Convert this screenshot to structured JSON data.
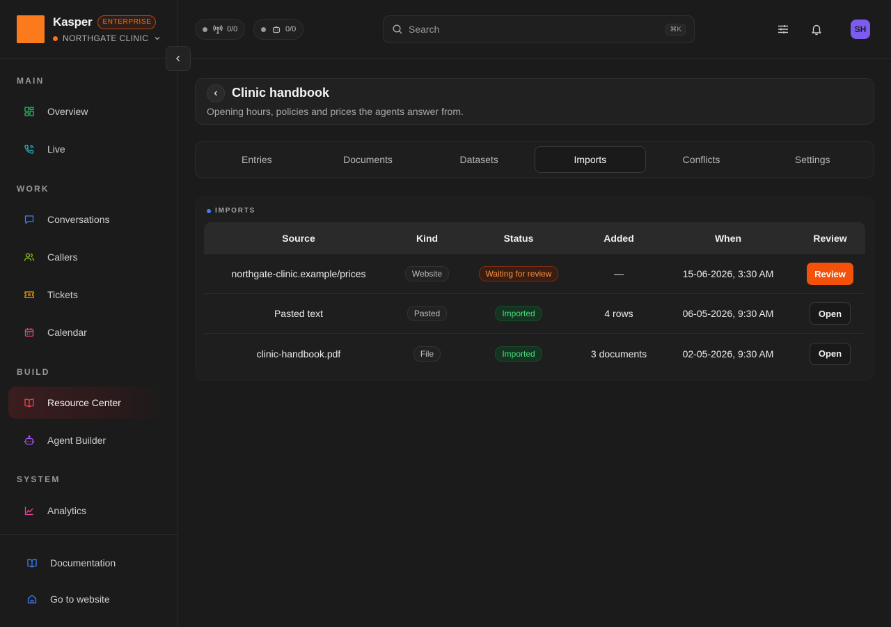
{
  "brand": {
    "name": "Kasper",
    "tier": "ENTERPRISE",
    "org": "NORTHGATE CLINIC"
  },
  "status_pills": [
    {
      "icon": "antenna-icon",
      "value": "0/0"
    },
    {
      "icon": "bot-icon",
      "value": "0/0"
    }
  ],
  "search": {
    "placeholder": "Search",
    "shortcut": "⌘K"
  },
  "user": {
    "initials": "SH"
  },
  "sidebar": {
    "sections": {
      "main": "MAIN",
      "work": "WORK",
      "build": "BUILD",
      "system": "SYSTEM"
    },
    "items": {
      "overview": "Overview",
      "live": "Live",
      "conversations": "Conversations",
      "callers": "Callers",
      "tickets": "Tickets",
      "calendar": "Calendar",
      "resource_center": "Resource Center",
      "agent_builder": "Agent Builder",
      "analytics": "Analytics",
      "documentation": "Documentation",
      "go_to_website": "Go to website"
    },
    "active": "resource_center",
    "icon_colors": {
      "overview": "#22c55e",
      "live": "#22b8cf",
      "conversations": "#3b82f6",
      "callers": "#84cc16",
      "tickets": "#f59e0b",
      "calendar": "#ec4899",
      "resource_center": "#ef4444",
      "agent_builder": "#a855f7",
      "analytics": "#ec4899",
      "documentation": "#3b82f6",
      "go_to_website": "#3b82f6"
    }
  },
  "page": {
    "title": "Clinic handbook",
    "subtitle": "Opening hours, policies and prices the agents answer from."
  },
  "tabs": [
    "Entries",
    "Documents",
    "Datasets",
    "Imports",
    "Conflicts",
    "Settings"
  ],
  "active_tab": "Imports",
  "imports": {
    "label": "IMPORTS",
    "columns": [
      "Source",
      "Kind",
      "Status",
      "Added",
      "When",
      "Review"
    ],
    "rows": [
      {
        "source": "northgate-clinic.example/prices",
        "kind": "Website",
        "status": "Waiting for review",
        "added": "—",
        "when": "15-06-2026, 3:30 AM",
        "action": "Review"
      },
      {
        "source": "Pasted text",
        "kind": "Pasted",
        "status": "Imported",
        "added": "4 rows",
        "when": "06-05-2026, 9:30 AM",
        "action": "Open"
      },
      {
        "source": "clinic-handbook.pdf",
        "kind": "File",
        "status": "Imported",
        "added": "3 documents",
        "when": "02-05-2026, 9:30 AM",
        "action": "Open"
      }
    ]
  },
  "colors": {
    "accent": "#f4510b",
    "brand_logo": "#fb7a1b",
    "waiting": "#fb923c",
    "imported": "#4ade80",
    "avatar": "#7c5cf0"
  }
}
